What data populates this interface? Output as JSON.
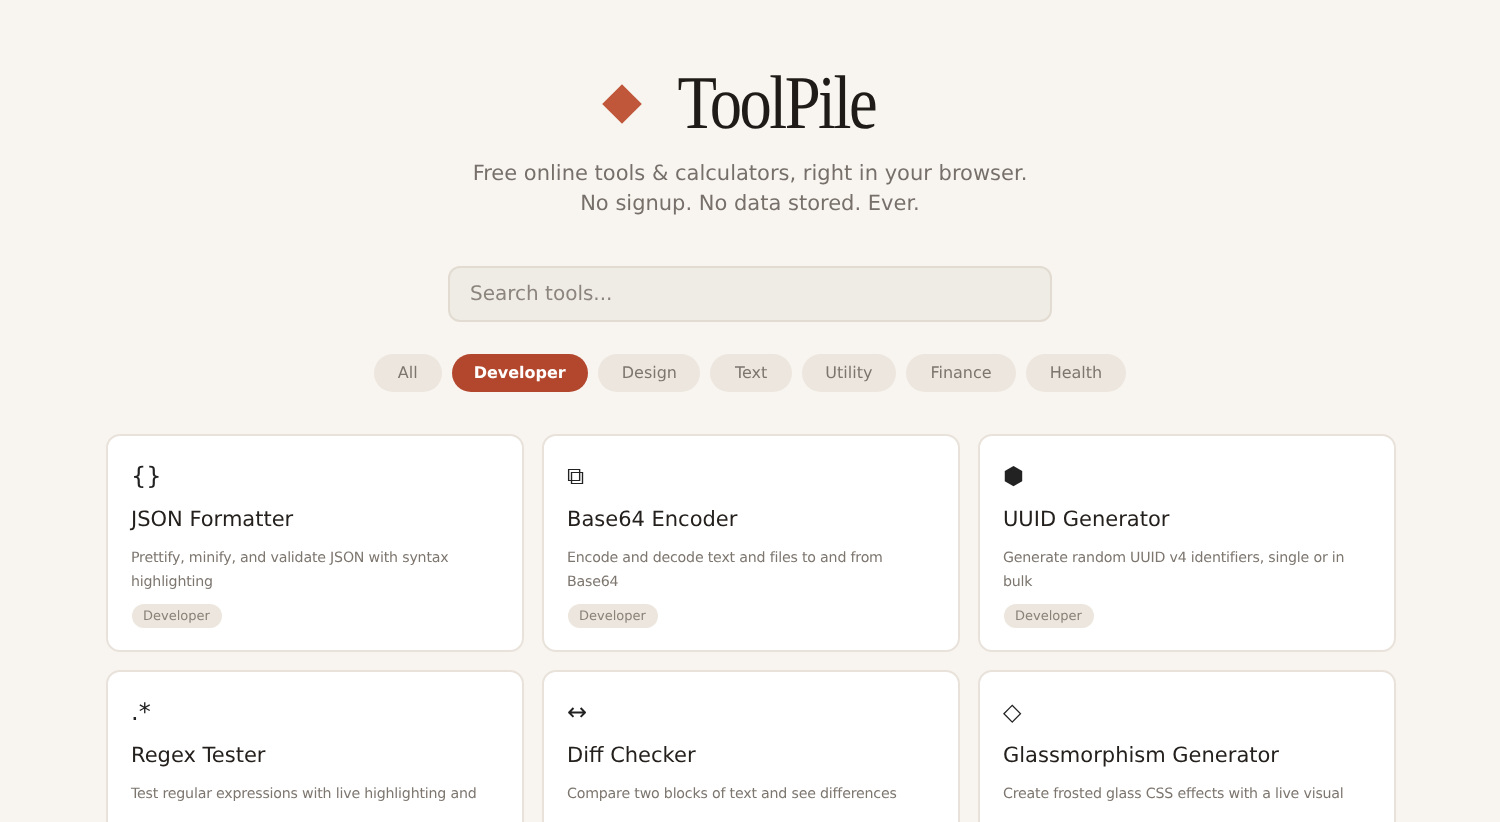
{
  "brand": {
    "name": "ToolPile"
  },
  "tagline": [
    "Free online tools & calculators, right in your browser.",
    "No signup. No data stored. Ever."
  ],
  "search": {
    "placeholder": "Search tools..."
  },
  "filters": [
    {
      "label": "All",
      "selected": false
    },
    {
      "label": "Developer",
      "selected": true
    },
    {
      "label": "Design",
      "selected": false
    },
    {
      "label": "Text",
      "selected": false
    },
    {
      "label": "Utility",
      "selected": false
    },
    {
      "label": "Finance",
      "selected": false
    },
    {
      "label": "Health",
      "selected": false
    }
  ],
  "tools": [
    {
      "icon": "{}",
      "title": "JSON Formatter",
      "description": "Prettify, minify, and validate JSON with syntax highlighting",
      "tag": "Developer"
    },
    {
      "icon": "⧉",
      "title": "Base64 Encoder",
      "description": "Encode and decode text and files to and from Base64",
      "tag": "Developer"
    },
    {
      "icon": "⬢",
      "title": "UUID Generator",
      "description": "Generate random UUID v4 identifiers, single or in bulk",
      "tag": "Developer"
    },
    {
      "icon": ".*",
      "title": "Regex Tester",
      "description": "Test regular expressions with live highlighting and"
    },
    {
      "icon": "↔",
      "title": "Diff Checker",
      "description": "Compare two blocks of text and see differences"
    },
    {
      "icon": "◇",
      "title": "Glassmorphism Generator",
      "description": "Create frosted glass CSS effects with a live visual"
    }
  ]
}
